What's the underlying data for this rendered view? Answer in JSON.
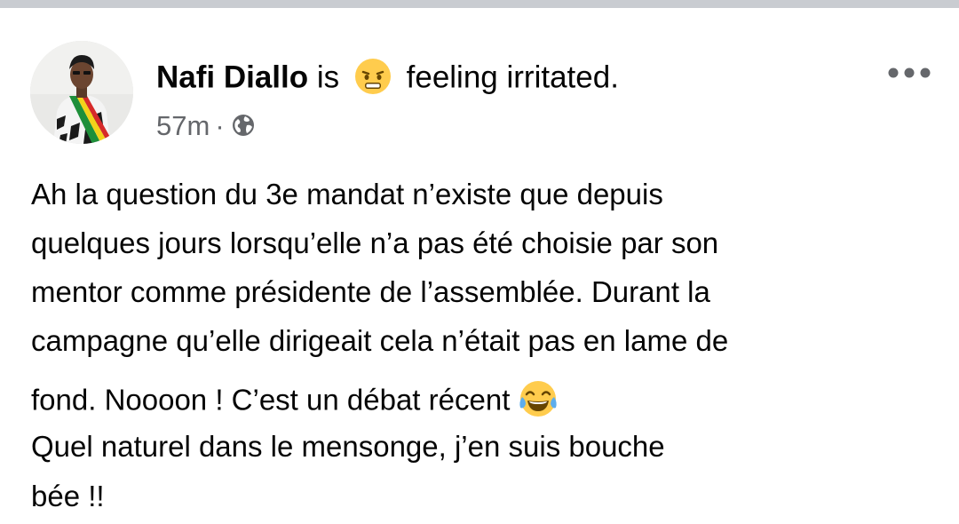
{
  "post": {
    "author": "Nafi Diallo",
    "feeling_connector": "is",
    "feeling_emoji_icon": "irritated-face-emoji-icon",
    "feeling_text": "feeling irritated.",
    "timestamp": "57m",
    "separator": "·",
    "privacy_icon": "globe-icon",
    "more_icon": "more-options-icon",
    "body_lines": [
      "Ah la question du 3e mandat n’existe que depuis",
      "quelques jours lorsqu’elle n’a pas été choisie par son",
      "mentor comme présidente de l’assemblée. Durant la",
      "campagne qu’elle dirigeait cela n’était pas en lame de",
      "fond. Noooon ! C’est un débat récent",
      "Quel naturel dans le mensonge, j’en suis bouche",
      "bée !!"
    ],
    "body_emoji_icon": "tears-of-joy-emoji-icon"
  },
  "colors": {
    "top_strip": "#c9ccd1",
    "text_primary": "#050505",
    "text_secondary": "#65676b",
    "emoji_yellow": "#ffcc4d"
  }
}
